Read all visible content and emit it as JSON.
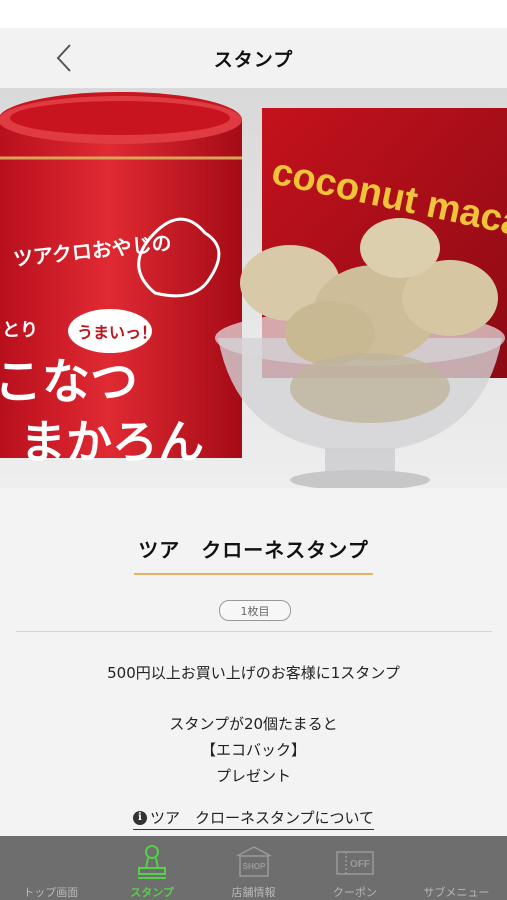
{
  "header": {
    "title": "スタンプ",
    "back_icon": "chevron-left-icon"
  },
  "hero": {
    "can_text_1": "ツアクロおやじの",
    "can_text_2": "うまいっ！",
    "can_text_3": "とり",
    "can_text_4": "こなつ",
    "can_text_5": "まかろん",
    "box_text": "coconut macaron"
  },
  "stamp": {
    "title": "ツア　クローネスタンプ",
    "count_label": "1枚目",
    "condition": "500円以上お買い上げのお客様に1スタンプ",
    "reward_line1": "スタンプが20個たまると",
    "reward_line2": "【エコバック】",
    "reward_line3": "プレゼント",
    "info_link": "ツア　クローネスタンプについて"
  },
  "tabbar": {
    "items": [
      {
        "label": "トップ画面",
        "icon": "home-icon",
        "active": false
      },
      {
        "label": "スタンプ",
        "icon": "stamp-icon",
        "active": true
      },
      {
        "label": "店舗情報",
        "icon": "shop-icon",
        "active": false
      },
      {
        "label": "クーポン",
        "icon": "coupon-icon",
        "active": false
      },
      {
        "label": "サブメニュー",
        "icon": "menu-icon",
        "active": false
      }
    ],
    "shop_icon_text": "SHOP",
    "coupon_icon_text": "OFF",
    "active_color": "#54d148",
    "inactive_color": "#b8b8b8"
  }
}
